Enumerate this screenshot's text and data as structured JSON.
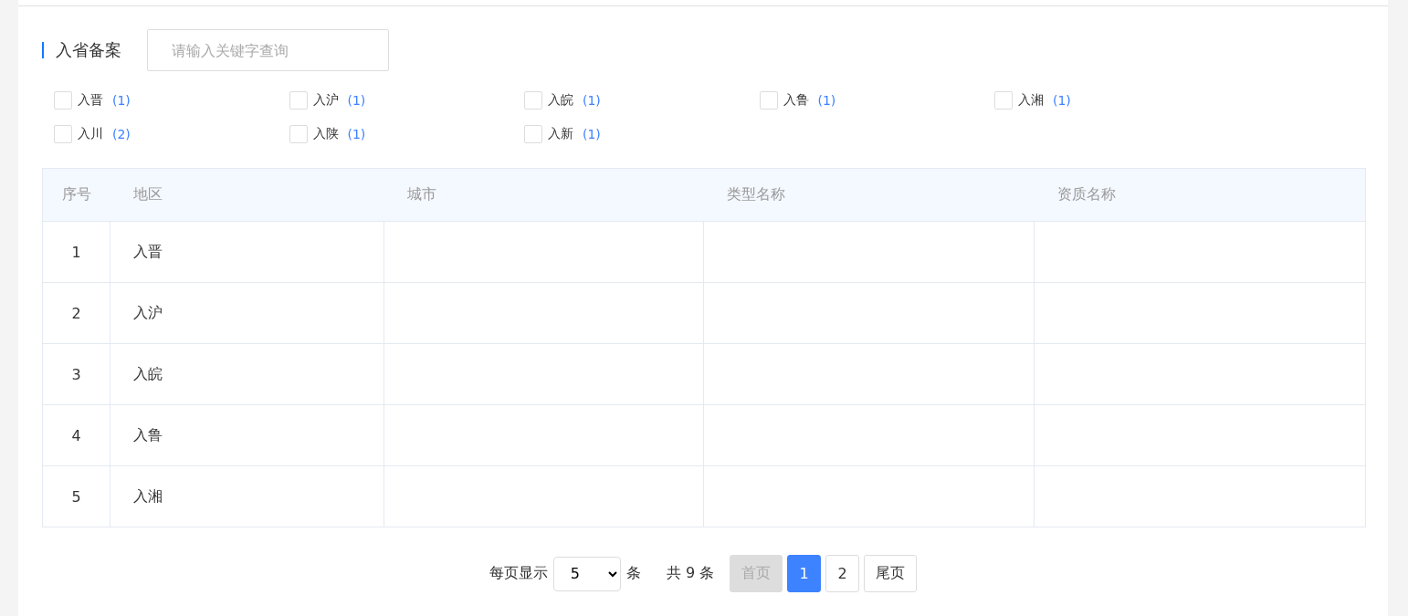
{
  "section": {
    "title": "入省备案",
    "search": {
      "placeholder": "请输入关键字查询"
    }
  },
  "filters": [
    {
      "label": "入晋",
      "count": "(1)",
      "checked": false
    },
    {
      "label": "入沪",
      "count": "(1)",
      "checked": false
    },
    {
      "label": "入皖",
      "count": "(1)",
      "checked": false
    },
    {
      "label": "入鲁",
      "count": "(1)",
      "checked": false
    },
    {
      "label": "入湘",
      "count": "(1)",
      "checked": false
    },
    {
      "label": "入川",
      "count": "(2)",
      "checked": false
    },
    {
      "label": "入陕",
      "count": "(1)",
      "checked": false
    },
    {
      "label": "入新",
      "count": "(1)",
      "checked": false
    }
  ],
  "table": {
    "columns": [
      "序号",
      "地区",
      "城市",
      "类型名称",
      "资质名称"
    ],
    "rows": [
      [
        "1",
        "入晋",
        "",
        "",
        ""
      ],
      [
        "2",
        "入沪",
        "",
        "",
        ""
      ],
      [
        "3",
        "入皖",
        "",
        "",
        ""
      ],
      [
        "4",
        "入鲁",
        "",
        "",
        ""
      ],
      [
        "5",
        "入湘",
        "",
        "",
        ""
      ]
    ]
  },
  "pagination": {
    "per_page_label": "每页显示",
    "per_page_value": "5",
    "unit": "条",
    "total": "共 9 条",
    "first": {
      "label": "首页",
      "disabled": true
    },
    "pages": [
      {
        "label": "1",
        "selected": true
      },
      {
        "label": "2",
        "selected": false
      }
    ],
    "last": {
      "label": "尾页",
      "disabled": false
    }
  }
}
